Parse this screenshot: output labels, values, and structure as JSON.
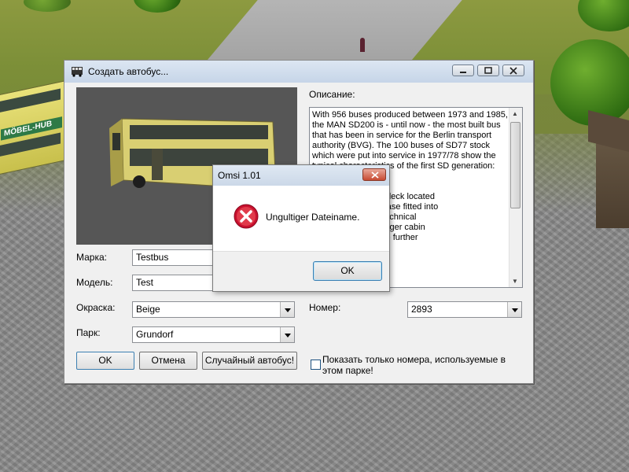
{
  "main_dialog": {
    "title": "Создать автобус...",
    "description_label": "Описание:",
    "description_text": "With 956 buses produced between 1973 and 1985, the MAN SD200 is - until now - the most built bus that has been in service for the Berlin transport authority (BVG). The 100 buses of SD77 stock which were put into service in 1977/78 show the typical characteristics of the first SD generation: They\n\n  case to the upper deck located\n  us and a rollsign case fitted into\n  on the right. The technical\n  ing into the passenger cabin\n  of the staircase are further\n  s of this bus type\n\n  tions -",
    "labels": {
      "brand": "Марка:",
      "model": "Модель:",
      "paint": "Окраска:",
      "depot": "Парк:",
      "number": "Номер:"
    },
    "values": {
      "brand": "Testbus",
      "model": "Test",
      "paint": "Beige",
      "depot": "Grundorf",
      "number": "2893"
    },
    "buttons": {
      "ok": "OK",
      "cancel": "Отмена",
      "random": "Случайный автобус!"
    },
    "checkbox_label": "Показать только номера, используемые в этом парке!",
    "checkbox_checked": false
  },
  "error_popup": {
    "title": "Omsi 1.01",
    "message": "Ungultiger Dateiname.",
    "ok_label": "OK",
    "icon": "error-icon"
  },
  "background": {
    "bus_sign_text": "MÖBEL-HUB"
  }
}
